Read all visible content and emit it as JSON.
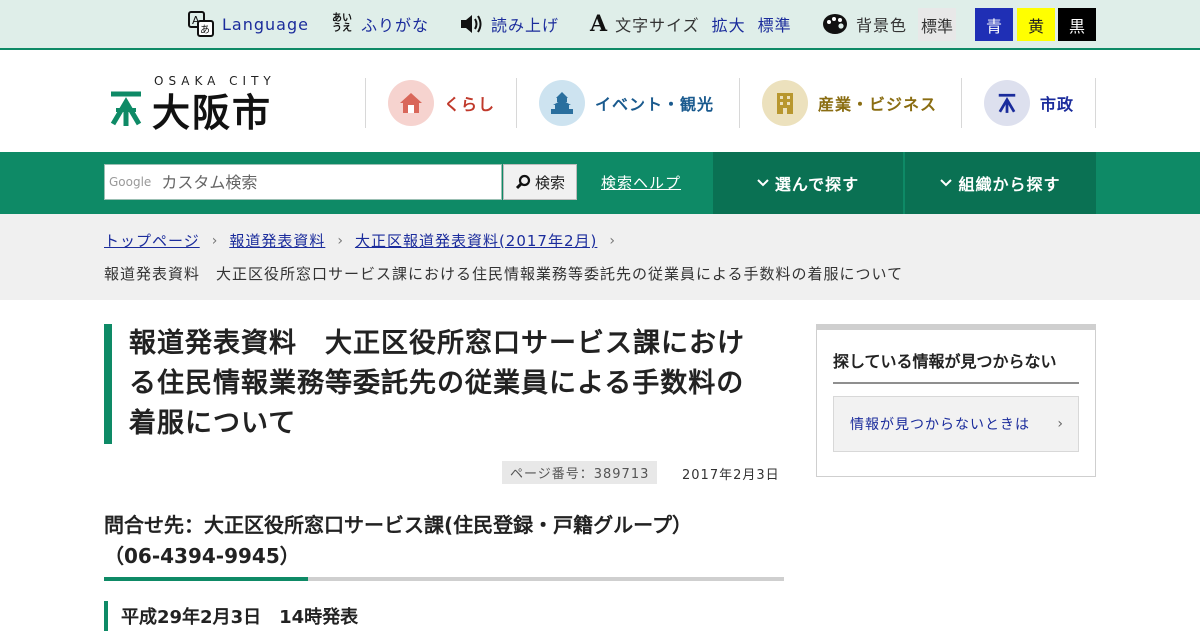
{
  "utility": {
    "language_label": "Language",
    "furigana_label": "ふりがな",
    "furigana_icon_text": "あい\nうえ",
    "readaloud_label": "読み上げ",
    "fontsize_label": "文字サイズ",
    "fontsize_icon_text": "A",
    "fontsize_enlarge": "拡大",
    "fontsize_standard": "標準",
    "bgcolor_label": "背景色",
    "bg_options": [
      {
        "label": "標準",
        "bg": "#e8e8e8",
        "fg": "#333333"
      },
      {
        "label": "青",
        "bg": "#1f2fb5",
        "fg": "#ffffff"
      },
      {
        "label": "黄",
        "bg": "#ffff00",
        "fg": "#222222"
      },
      {
        "label": "黒",
        "bg": "#000000",
        "fg": "#ffffff"
      }
    ]
  },
  "header": {
    "logo_en": "OSAKA CITY",
    "logo_ja": "大阪市",
    "categories": [
      {
        "label": "くらし",
        "color": "#c0392b",
        "circle": "#f6d3cf"
      },
      {
        "label": "イベント・観光",
        "color": "#1a5a8e",
        "circle": "#cde3f0"
      },
      {
        "label": "産業・ビジネス",
        "color": "#8a6d12",
        "circle": "#ece1bd"
      },
      {
        "label": "市政",
        "color": "#1b2c9c",
        "circle": "#dde0ee"
      }
    ]
  },
  "search": {
    "google_label": "Google",
    "placeholder": "カスタム検索",
    "button_label": "検索",
    "help_label": "検索ヘルプ",
    "dropdown_choose": "選んで探す",
    "dropdown_org": "組織から探す"
  },
  "breadcrumb": {
    "items": [
      "トップページ",
      "報道発表資料",
      "大正区報道発表資料(2017年2月)"
    ],
    "current": "報道発表資料　大正区役所窓口サービス課における住民情報業務等委託先の従業員による手数料の着服について"
  },
  "main": {
    "title_lines": [
      "報道発表資料　大正区役所窓口サービス課におけ",
      "る住民情報業務等委託先の従業員による手数料の",
      "着服について"
    ],
    "page_number": "ページ番号：389713",
    "date": "2017年2月3日",
    "contact_line1": "問合せ先：大正区役所窓口サービス課(住民登録・戸籍グループ）",
    "contact_line2": "（06-4394-9945）",
    "release": "平成29年2月3日　14時発表"
  },
  "sidebar": {
    "title": "探している情報が見つからない",
    "link": "情報が見つからないときは"
  },
  "colors": {
    "brand_green": "#0e8a66",
    "brand_green_dark": "#0a7153",
    "link_blue": "#1b2c9c"
  }
}
